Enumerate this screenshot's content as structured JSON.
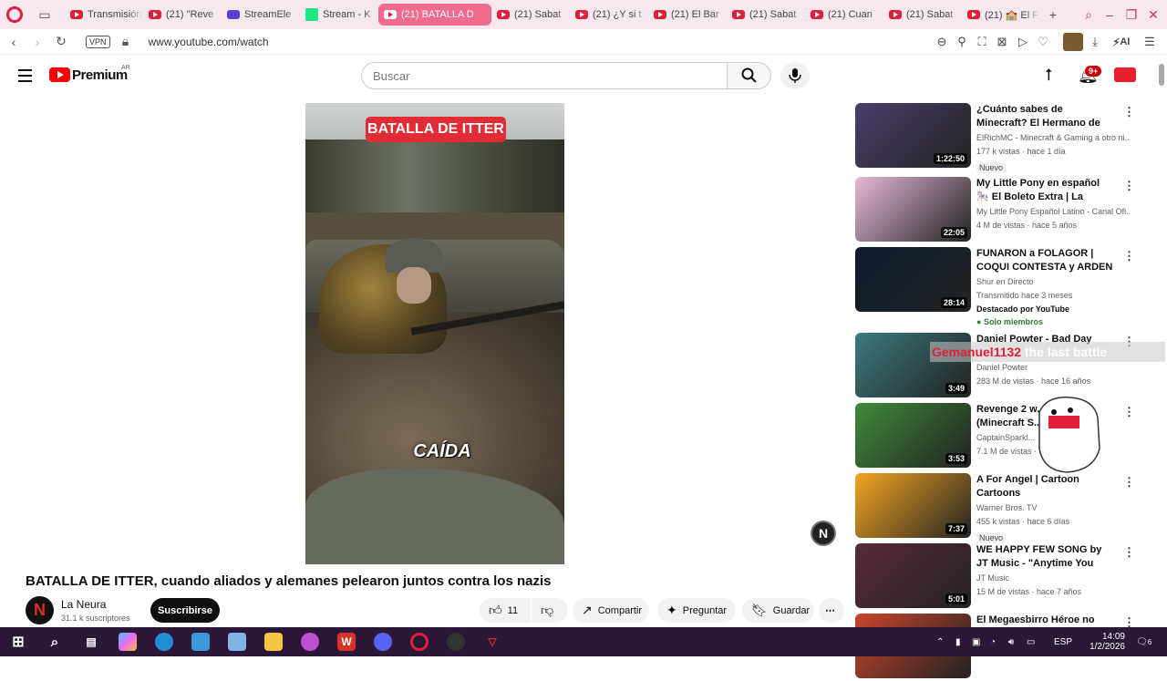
{
  "browser": {
    "tabs": [
      {
        "label": "Transmisión",
        "kind": "yt"
      },
      {
        "label": "(21) \"Reve",
        "kind": "yt"
      },
      {
        "label": "StreamEle",
        "kind": "twitch"
      },
      {
        "label": "Stream - K",
        "kind": "kick"
      },
      {
        "label": "(21) BATALLA D",
        "kind": "yt",
        "active": true
      },
      {
        "label": "(21) Sabat",
        "kind": "yt"
      },
      {
        "label": "(21) ¿Y si t",
        "kind": "yt"
      },
      {
        "label": "(21) El Bar",
        "kind": "yt"
      },
      {
        "label": "(21) Sabat",
        "kind": "yt"
      },
      {
        "label": "(21) Cuan",
        "kind": "yt"
      },
      {
        "label": "(21) Sabat",
        "kind": "yt"
      },
      {
        "label": "(21) 🏫 El F",
        "kind": "yt"
      }
    ],
    "vpn_label": "VPN",
    "url": "www.youtube.com/watch",
    "ai_label": "AI"
  },
  "youtube": {
    "logo_text": "Premium",
    "region": "AR",
    "search_placeholder": "Buscar",
    "notif_count": "9+"
  },
  "video": {
    "overlay_title": "BATALLA DE ITTER",
    "caption": "CAÍDA",
    "title": "BATALLA DE ITTER, cuando aliados y alemanes pelearon juntos contra los nazis",
    "channel": "La Neura",
    "subscribers": "31.1 k suscriptores",
    "subscribe_label": "Suscribirse",
    "likes": "11",
    "share_label": "Compartir",
    "ask_label": "Preguntar",
    "save_label": "Guardar",
    "float_logo": "N"
  },
  "recommendations": [
    {
      "title": "¿Cuánto sabes de Minecraft? El Hermano de ElRichMC y ...",
      "channel": "ElRichMC - Minecraft & Gaming a otro ni...",
      "stats": "177 k vistas · hace 1 día",
      "duration": "1:22:50",
      "tag": "Nuevo",
      "thumb": "#4a3f6b"
    },
    {
      "title": "My Little Pony en español 🎠 El Boleto Extra | La Magia de la ...",
      "channel": "My Little Pony Español Latino - Canal Ofi...",
      "stats": "4 M de vistas · hace 5 años",
      "duration": "22:05",
      "thumb": "#e7b8d8"
    },
    {
      "title": "FUNARON a FOLAGOR | COQUI CONTESTA y ARDEN LAS ...",
      "channel": "Shur en Directo",
      "stats": "Transmitido hace 3 meses",
      "extra": "Destacado por YouTube",
      "members": "Solo miembros",
      "duration": "28:14",
      "thumb": "#0c1c2e"
    },
    {
      "title": "Daniel Powter - Bad Day",
      "channel": "Daniel Powter",
      "stats": "283 M de vistas · hace 16 años",
      "duration": "3:49",
      "thumb": "#3c7a7e"
    },
    {
      "title": "Revenge 2 w... Audio (Minecraft S...",
      "channel": "CaptainSparkl...",
      "stats": "7.1 M de vistas · ...",
      "duration": "3:53",
      "thumb": "#3f8a3a"
    },
    {
      "title": "A For Angel | Cartoon Cartoons",
      "channel": "Warner Bros. TV",
      "stats": "455 k vistas · hace 6 días",
      "duration": "7:37",
      "tag": "Nuevo",
      "thumb": "#f5a623"
    },
    {
      "title": "WE HAPPY FEW SONG by JT Music - \"Anytime You Smile\"",
      "channel": "JT Music",
      "stats": "15 M de vistas · hace 7 años",
      "duration": "5:01",
      "thumb": "#5a2a3a"
    },
    {
      "title": "El Megaesbirro Héroe no Tiene",
      "thumb": "#c8452c"
    }
  ],
  "overlay": {
    "name": "Gemanuel1132",
    "text": "the last battle"
  },
  "taskbar": {
    "lang": "ESP",
    "time": "14:09",
    "date": "1/2/2026",
    "notif": "6"
  },
  "colors": {
    "accent": "#ff0000",
    "tab_active": "#f06b8d",
    "taskbar": "#2b1836"
  }
}
